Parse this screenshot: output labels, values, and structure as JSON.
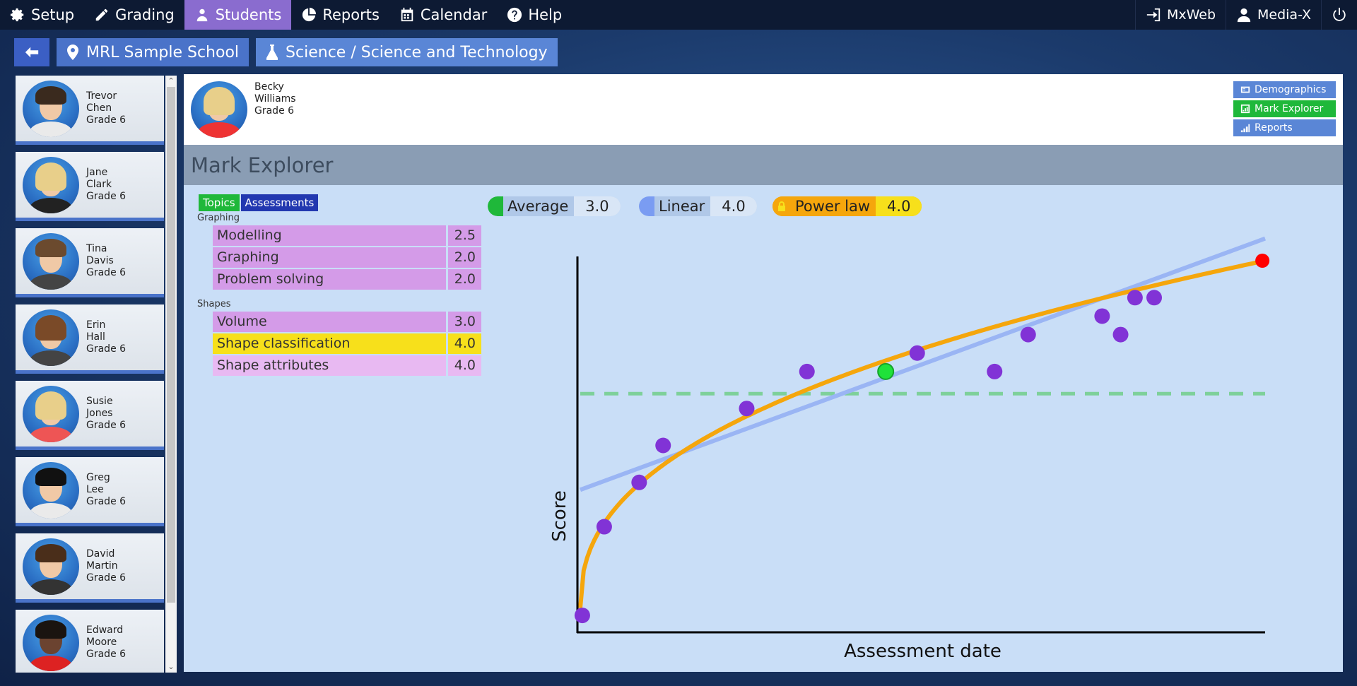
{
  "nav": {
    "items": [
      {
        "label": "Setup",
        "icon": "gear-icon"
      },
      {
        "label": "Grading",
        "icon": "pencil-icon"
      },
      {
        "label": "Students",
        "icon": "person-icon"
      },
      {
        "label": "Reports",
        "icon": "pie-icon"
      },
      {
        "label": "Calendar",
        "icon": "calendar-icon"
      },
      {
        "label": "Help",
        "icon": "help-icon"
      }
    ],
    "active": "Students",
    "right": {
      "mxweb": "MxWeb",
      "user": "Media-X"
    }
  },
  "breadcrumb": {
    "school": "MRL Sample School",
    "subject": "Science / Science and Technology"
  },
  "students": [
    {
      "first": "Trevor",
      "last": "Chen",
      "grade": "Grade 6"
    },
    {
      "first": "Jane",
      "last": "Clark",
      "grade": "Grade 6"
    },
    {
      "first": "Tina",
      "last": "Davis",
      "grade": "Grade 6"
    },
    {
      "first": "Erin",
      "last": "Hall",
      "grade": "Grade 6"
    },
    {
      "first": "Susie",
      "last": "Jones",
      "grade": "Grade 6"
    },
    {
      "first": "Greg",
      "last": "Lee",
      "grade": "Grade 6"
    },
    {
      "first": "David",
      "last": "Martin",
      "grade": "Grade 6"
    },
    {
      "first": "Edward",
      "last": "Moore",
      "grade": "Grade 6"
    }
  ],
  "selected_student": {
    "first": "Becky",
    "last": "Williams",
    "grade": "Grade 6"
  },
  "side_buttons": {
    "demographics": "Demographics",
    "mark_explorer": "Mark Explorer",
    "reports": "Reports"
  },
  "section_title": "Mark Explorer",
  "tabs": {
    "topics": "Topics",
    "assessments": "Assessments"
  },
  "groups": [
    {
      "name": "Graphing",
      "topics": [
        {
          "name": "Modelling",
          "value": "2.5",
          "color": "#d49be8"
        },
        {
          "name": "Graphing",
          "value": "2.0",
          "color": "#d49be8"
        },
        {
          "name": "Problem solving",
          "value": "2.0",
          "color": "#d49be8"
        }
      ]
    },
    {
      "name": "Shapes",
      "topics": [
        {
          "name": "Volume",
          "value": "3.0",
          "color": "#d49be8"
        },
        {
          "name": "Shape classification",
          "value": "4.0",
          "color": "#f7e01b"
        },
        {
          "name": "Shape attributes",
          "value": "4.0",
          "color": "#e8b9f2"
        }
      ]
    }
  ],
  "legend": {
    "average": {
      "label": "Average",
      "value": "3.0",
      "color": "#1fb83a"
    },
    "linear": {
      "label": "Linear",
      "value": "4.0",
      "color": "#7a9cf2"
    },
    "power": {
      "label": "Power law",
      "value": "4.0",
      "color": "#f5a60c"
    }
  },
  "chart_data": {
    "type": "scatter",
    "xlabel": "Assessment date",
    "ylabel": "Score",
    "xlim": [
      0,
      100
    ],
    "ylim": [
      0,
      5
    ],
    "points": [
      {
        "x": 0.3,
        "y": 0.2
      },
      {
        "x": 3.5,
        "y": 1.4
      },
      {
        "x": 8.6,
        "y": 2.0
      },
      {
        "x": 12.1,
        "y": 2.5
      },
      {
        "x": 24.3,
        "y": 3.0
      },
      {
        "x": 33.1,
        "y": 3.5
      },
      {
        "x": 44.6,
        "y": 3.5,
        "highlight": true
      },
      {
        "x": 49.2,
        "y": 3.75
      },
      {
        "x": 60.5,
        "y": 3.5
      },
      {
        "x": 65.4,
        "y": 4.0
      },
      {
        "x": 76.2,
        "y": 4.25
      },
      {
        "x": 78.9,
        "y": 4.0
      },
      {
        "x": 81.0,
        "y": 4.5
      },
      {
        "x": 83.8,
        "y": 4.5
      }
    ],
    "final_point": {
      "x": 99.6,
      "y": 5.0
    },
    "average": 3.2,
    "linear": {
      "y0": 1.9,
      "y1": 5.3,
      "x_end": 100
    },
    "power_law": {
      "a": 0.15,
      "b": 0.27,
      "c": 0.3
    },
    "colors": {
      "points": "#8133d6",
      "highlight": "#1fe23a",
      "final": "#f00",
      "power": "#f5a60c",
      "linear": "#9ab5f4",
      "average": "#7ed09a"
    }
  }
}
